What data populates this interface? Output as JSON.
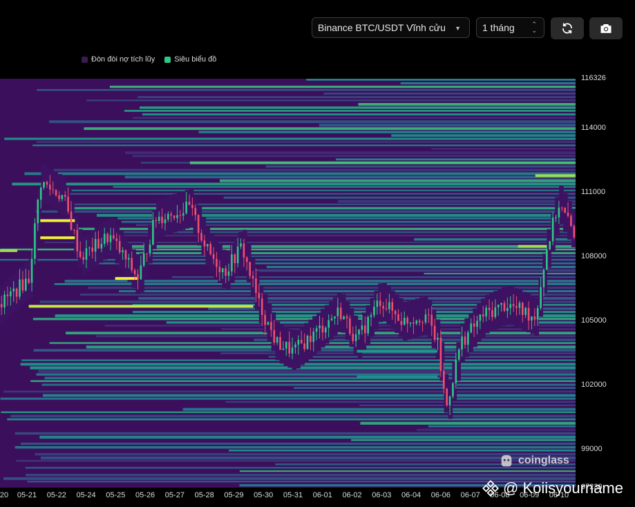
{
  "toolbar": {
    "pair_value": "Binance BTC/USDT Vĩnh cửu",
    "period_value": "1 tháng",
    "refresh_icon": "refresh-icon",
    "camera_icon": "camera-icon"
  },
  "colors": {
    "background": "#000000",
    "leverage": "#3a1a4f",
    "liquidation": "#2ec986",
    "heat_low": "#3b0f5c",
    "heat_mid": "#1f9a8a",
    "heat_high": "#f0f03a",
    "candle_up": "#2ec986",
    "candle_down": "#f0506e"
  },
  "chart_data": {
    "type": "heatmap",
    "legend": [
      {
        "name": "Đòn đòi nợ tích lũy",
        "color": "#3a1a4f"
      },
      {
        "name": "Siêu biểu đồ",
        "color": "#2ec986"
      }
    ],
    "y_ticks": [
      "116326",
      "114000",
      "111000",
      "108000",
      "105000",
      "102000",
      "99000",
      "97230"
    ],
    "ylim": [
      97230,
      116326
    ],
    "x_ticks": [
      "20",
      "05-21",
      "05-22",
      "05-24",
      "05-25",
      "05-26",
      "05-27",
      "05-28",
      "05-29",
      "05-30",
      "05-31",
      "06-01",
      "06-02",
      "06-03",
      "06-04",
      "06-06",
      "06-07",
      "06-08",
      "06-09",
      "06-10"
    ],
    "price_path": [
      {
        "x": 0.0,
        "y": 105800
      },
      {
        "x": 0.05,
        "y": 107000
      },
      {
        "x": 0.07,
        "y": 111500
      },
      {
        "x": 0.11,
        "y": 110800
      },
      {
        "x": 0.14,
        "y": 108000
      },
      {
        "x": 0.19,
        "y": 109000
      },
      {
        "x": 0.24,
        "y": 107000
      },
      {
        "x": 0.27,
        "y": 109800
      },
      {
        "x": 0.33,
        "y": 110300
      },
      {
        "x": 0.36,
        "y": 108300
      },
      {
        "x": 0.39,
        "y": 107300
      },
      {
        "x": 0.42,
        "y": 108500
      },
      {
        "x": 0.45,
        "y": 105800
      },
      {
        "x": 0.48,
        "y": 104000
      },
      {
        "x": 0.51,
        "y": 103600
      },
      {
        "x": 0.55,
        "y": 104500
      },
      {
        "x": 0.59,
        "y": 105500
      },
      {
        "x": 0.62,
        "y": 104100
      },
      {
        "x": 0.66,
        "y": 106000
      },
      {
        "x": 0.7,
        "y": 105000
      },
      {
        "x": 0.74,
        "y": 105300
      },
      {
        "x": 0.76,
        "y": 104000
      },
      {
        "x": 0.775,
        "y": 100900
      },
      {
        "x": 0.8,
        "y": 104000
      },
      {
        "x": 0.84,
        "y": 105300
      },
      {
        "x": 0.88,
        "y": 105800
      },
      {
        "x": 0.93,
        "y": 105200
      },
      {
        "x": 0.95,
        "y": 108400
      },
      {
        "x": 0.97,
        "y": 110500
      },
      {
        "x": 1.0,
        "y": 109000
      }
    ],
    "bright_levels": [
      {
        "price": 112400,
        "from": 0.33,
        "to": 1.0,
        "level": 0.75
      },
      {
        "price": 111800,
        "from": 0.93,
        "to": 1.0,
        "level": 0.9
      },
      {
        "price": 109700,
        "from": 0.07,
        "to": 0.13,
        "level": 1.0
      },
      {
        "price": 108900,
        "from": 0.07,
        "to": 0.13,
        "level": 1.0
      },
      {
        "price": 108300,
        "from": 0.0,
        "to": 0.03,
        "level": 0.9
      },
      {
        "price": 108500,
        "from": 0.9,
        "to": 0.95,
        "level": 0.9
      },
      {
        "price": 107000,
        "from": 0.2,
        "to": 0.24,
        "level": 1.0
      },
      {
        "price": 105700,
        "from": 0.05,
        "to": 0.44,
        "level": 0.95
      },
      {
        "price": 103600,
        "from": 0.62,
        "to": 0.76,
        "level": 0.6
      },
      {
        "price": 102400,
        "from": 0.62,
        "to": 0.76,
        "level": 0.55
      }
    ]
  },
  "watermark": {
    "brand": "coinglass",
    "handle": "@ Koiisyourname"
  }
}
